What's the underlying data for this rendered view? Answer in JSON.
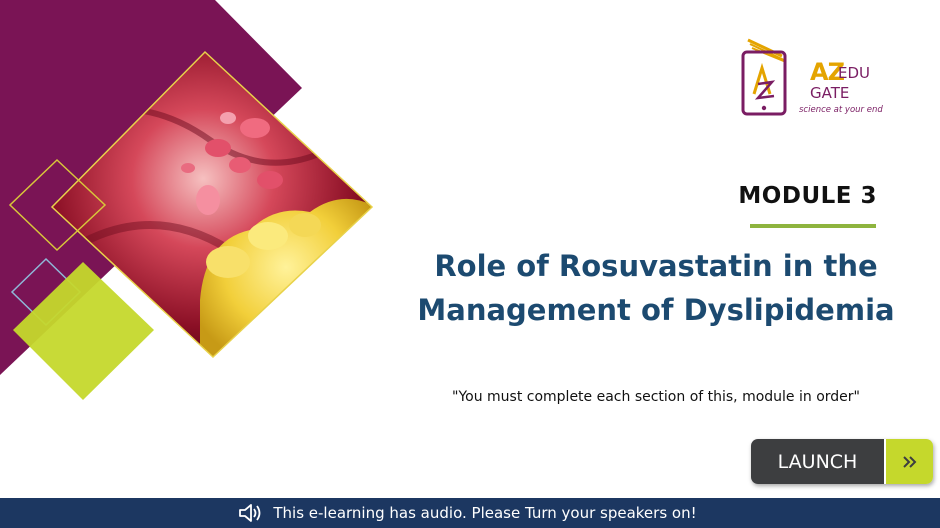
{
  "logo": {
    "brand_az": "AZ",
    "brand_edu": "EDU",
    "brand_gate": "GATE",
    "tagline": "science at your end"
  },
  "module": {
    "label": "MODULE 3"
  },
  "title": {
    "line1": "Role of Rosuvastatin in the",
    "line2": "Management of Dyslipidemia"
  },
  "note": "\"You must complete each section of this, module in order\"",
  "launch_button": {
    "label": "LAUNCH",
    "icon": "double-chevron-right-icon"
  },
  "footer": {
    "icon": "speaker-audio-icon",
    "text": "This e-learning has audio. Please Turn your speakers on!"
  },
  "colors": {
    "purple": "#7a1455",
    "lime": "#c5d82c",
    "title_blue": "#1c4a70",
    "footer_navy": "#1c3761",
    "button_dark": "#3d3e40",
    "rule_green": "#8eb43e"
  }
}
